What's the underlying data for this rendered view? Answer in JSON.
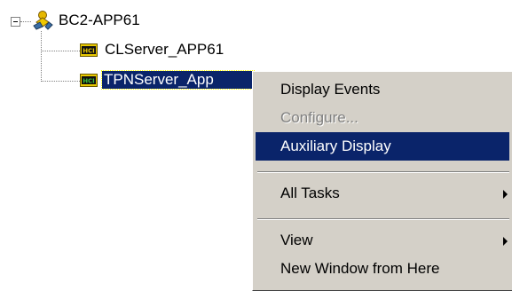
{
  "tree": {
    "root": {
      "label": "BC2-APP61",
      "icon": "server-node-icon",
      "expanded": true
    },
    "children": [
      {
        "label": "CLServer_APP61",
        "icon": "hci-icon",
        "selected": false
      },
      {
        "label": "TPNServer_App",
        "icon": "hci-icon",
        "selected": true
      }
    ],
    "hci_badge": "HCI"
  },
  "context_menu": {
    "items": [
      {
        "label": "Display Events",
        "state": "normal"
      },
      {
        "label": "Configure...",
        "state": "disabled"
      },
      {
        "label": "Auxiliary Display",
        "state": "highlighted"
      },
      {
        "label": "All Tasks",
        "state": "normal",
        "submenu": true
      },
      {
        "label": "View",
        "state": "normal",
        "submenu": true
      },
      {
        "label": "New Window from Here",
        "state": "normal"
      }
    ]
  },
  "colors": {
    "selection": "#0a246a",
    "menu_background": "#d4d0c8",
    "disabled_text": "#808080"
  }
}
